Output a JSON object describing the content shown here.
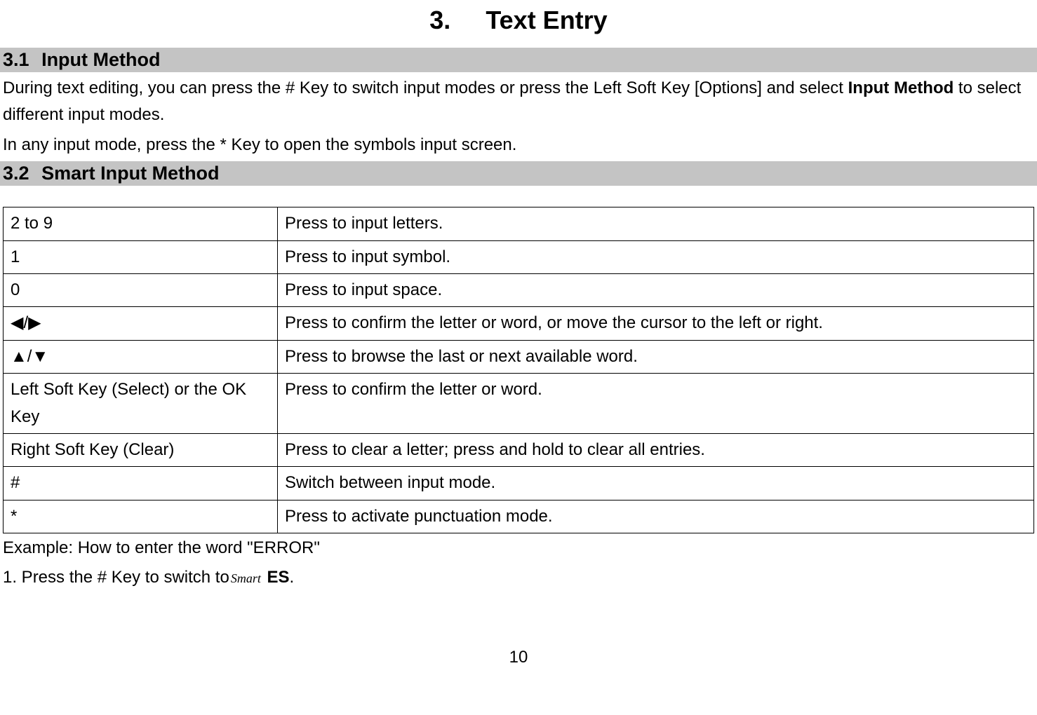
{
  "chapter": {
    "number": "3.",
    "title": "Text Entry"
  },
  "section31": {
    "number": "3.1",
    "title": "Input Method",
    "p1a": "During text editing, you can press the # Key to switch input modes or press the Left Soft Key [Options] and select ",
    "p1bold": "Input Method",
    "p1b": " to select different input modes.",
    "p2": "In any input mode, press the * Key to open the symbols input screen."
  },
  "section32": {
    "number": "3.2",
    "title": "Smart Input Method"
  },
  "table": {
    "rows": [
      {
        "key": "2 to 9",
        "desc": "Press to input letters."
      },
      {
        "key": "1",
        "desc": "Press to input symbol."
      },
      {
        "key": "0",
        "desc": "Press to input space."
      },
      {
        "key": "◀/▶",
        "desc": "Press to confirm the letter or word, or move the cursor to the left or right."
      },
      {
        "key": "▲/▼",
        "desc": "Press to browse the last or next available word."
      },
      {
        "key": "Left Soft Key (Select) or the OK Key",
        "desc": "Press to confirm the letter or word."
      },
      {
        "key": "Right Soft Key (Clear)",
        "desc": "Press to clear a letter; press and hold to clear all entries."
      },
      {
        "key": "#",
        "desc": "Switch between input mode."
      },
      {
        "key": "*",
        "desc": "Press to activate punctuation mode."
      }
    ]
  },
  "example": {
    "title": "Example: How to enter the word \"ERROR\"",
    "step1a": "1. Press the # Key to switch to",
    "smart_icon_label": "Smart",
    "step1b": " ES",
    "step1c": "."
  },
  "pageNumber": "10"
}
